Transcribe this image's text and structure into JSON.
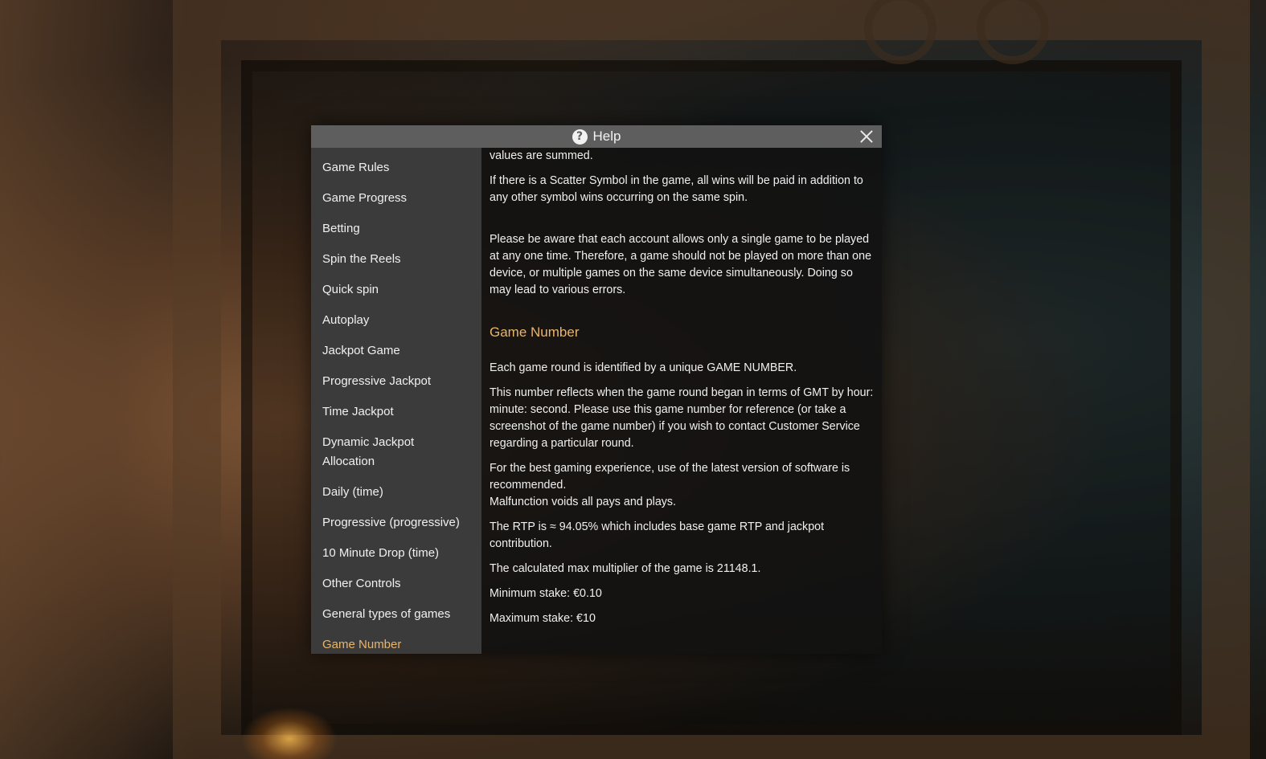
{
  "dialog": {
    "title": "Help",
    "icons": {
      "help": "question-circle-icon",
      "close": "close-icon"
    }
  },
  "sidebar": {
    "items": [
      {
        "label": "Game Rules"
      },
      {
        "label": "Game Progress"
      },
      {
        "label": "Betting"
      },
      {
        "label": "Spin the Reels"
      },
      {
        "label": "Quick spin"
      },
      {
        "label": "Autoplay"
      },
      {
        "label": "Jackpot Game"
      },
      {
        "label": "Progressive Jackpot"
      },
      {
        "label": "Time Jackpot"
      },
      {
        "label": "Dynamic Jackpot Allocation"
      },
      {
        "label": "Daily (time)"
      },
      {
        "label": "Progressive (progressive)"
      },
      {
        "label": "10 Minute Drop (time)"
      },
      {
        "label": "Other Controls"
      },
      {
        "label": "General types of games"
      },
      {
        "label": "Game Number"
      }
    ],
    "active": "Game Number"
  },
  "content": {
    "p_cut": "values are summed.",
    "p_scatter": "If there is a Scatter Symbol in the game, all wins will be paid in addition to any other symbol wins occurring on the same spin.",
    "p_account": "Please be aware that each account allows only a single game to be played at any one time. Therefore, a game should not be played on more than one device, or multiple games on the same device simultaneously. Doing so may lead to various errors.",
    "heading": "Game Number",
    "p_identified": "Each game round is identified by a unique GAME NUMBER.",
    "p_reflects": "This number reflects when the game round began in terms of GMT by hour: minute: second. Please use this game number for reference (or take a screenshot of the game number) if you wish to contact Customer Service regarding a particular round.",
    "p_best": "For the best gaming experience, use of the latest version of software is recommended.",
    "p_malfunction": "Malfunction voids all pays and plays.",
    "p_rtp": "The RTP is ≈ 94.05% which includes base game RTP and jackpot contribution.",
    "p_max_mult": "The calculated max multiplier of the game is 21148.1.",
    "p_min_stake": "Minimum stake: €0.10",
    "p_max_stake": "Maximum stake: €10"
  },
  "colors": {
    "accent": "#e8b56c",
    "titlebar": "#5e5e5e",
    "sidebar": "#3b3b3b"
  }
}
